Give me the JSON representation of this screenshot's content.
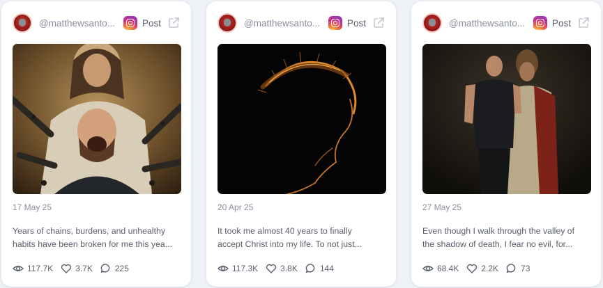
{
  "cards": [
    {
      "handle": "@matthewsanto...",
      "platform_label": "Post",
      "date": "17 May 25",
      "caption_lines": [
        "Years of chains, burdens, and unhealthy",
        "habits have been broken for me this yea..."
      ],
      "views": "117.7K",
      "likes": "3.7K",
      "comments": "225"
    },
    {
      "handle": "@matthewsanto...",
      "platform_label": "Post",
      "date": "20 Apr 25",
      "caption_lines": [
        "It took me almost 40 years to finally",
        "accept Christ into my life. To not just..."
      ],
      "views": "117.3K",
      "likes": "3.8K",
      "comments": "144"
    },
    {
      "handle": "@matthewsanto...",
      "platform_label": "Post",
      "date": "27 May 25",
      "caption_lines": [
        "Even though I walk through the valley of",
        "the shadow of death, I fear no evil, for..."
      ],
      "views": "68.4K",
      "likes": "2.2K",
      "comments": "73"
    }
  ],
  "icons": {
    "platform": "instagram-icon",
    "open": "external-link-icon",
    "views": "eye-icon",
    "likes": "heart-icon",
    "comments": "comment-icon"
  },
  "colors": {
    "background": "#eef1f6",
    "card": "#ffffff",
    "muted_text": "#8b90a0",
    "body_text": "#5a5f6d"
  }
}
